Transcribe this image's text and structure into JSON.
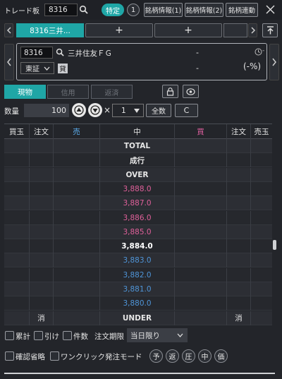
{
  "header": {
    "title": "トレード板",
    "code": "8316",
    "specific_badge": "特定",
    "account_num": "1",
    "tabs": [
      "銘柄情報(1)",
      "銘柄情報(2)",
      "銘柄連動"
    ]
  },
  "stock_tabs": {
    "active": "8316三井...",
    "plus": [
      "+",
      "+"
    ]
  },
  "stock": {
    "code": "8316",
    "name": "三井住友ＦＧ",
    "price": "-",
    "change": "-",
    "change_pct": "(-%)",
    "market": "東証",
    "lending_badge": "貸"
  },
  "order_type_tabs": [
    "現物",
    "信用",
    "返済"
  ],
  "quantity": {
    "label": "数量",
    "value": "100",
    "multiply": "×",
    "multiplier": "1",
    "all_label": "全数",
    "clear_label": "C"
  },
  "board": {
    "headers": [
      "買玉",
      "注文",
      "売",
      "中",
      "買",
      "注文",
      "売玉"
    ],
    "rows": [
      {
        "center": "TOTAL",
        "type": "label"
      },
      {
        "center": "成行",
        "type": "label"
      },
      {
        "center": "OVER",
        "type": "label"
      },
      {
        "center": "3,888.0",
        "type": "sell"
      },
      {
        "center": "3,887.0",
        "type": "sell"
      },
      {
        "center": "3,886.0",
        "type": "sell"
      },
      {
        "center": "3,885.0",
        "type": "sell"
      },
      {
        "center": "3,884.0",
        "type": "mid"
      },
      {
        "center": "3,883.0",
        "type": "buy"
      },
      {
        "center": "3,882.0",
        "type": "buy"
      },
      {
        "center": "3,881.0",
        "type": "buy"
      },
      {
        "center": "3,880.0",
        "type": "buy"
      }
    ],
    "footer_left": "消",
    "footer_center": "UNDER",
    "footer_right": "消"
  },
  "options": {
    "cumulative": "累計",
    "close": "引け",
    "count": "件数",
    "period_label": "注文期限",
    "period_value": "当日限り",
    "skip_confirm": "確認省略",
    "one_click": "ワンクリック発注モード",
    "circle_buttons": [
      "予",
      "返",
      "圧",
      "中",
      "価"
    ]
  },
  "colors": {
    "accent": "#1fa6a6",
    "sell_price": "#e0609a",
    "buy_price": "#4f95d8",
    "sell_header": "#5aaae8",
    "buy_header": "#e060a0"
  }
}
